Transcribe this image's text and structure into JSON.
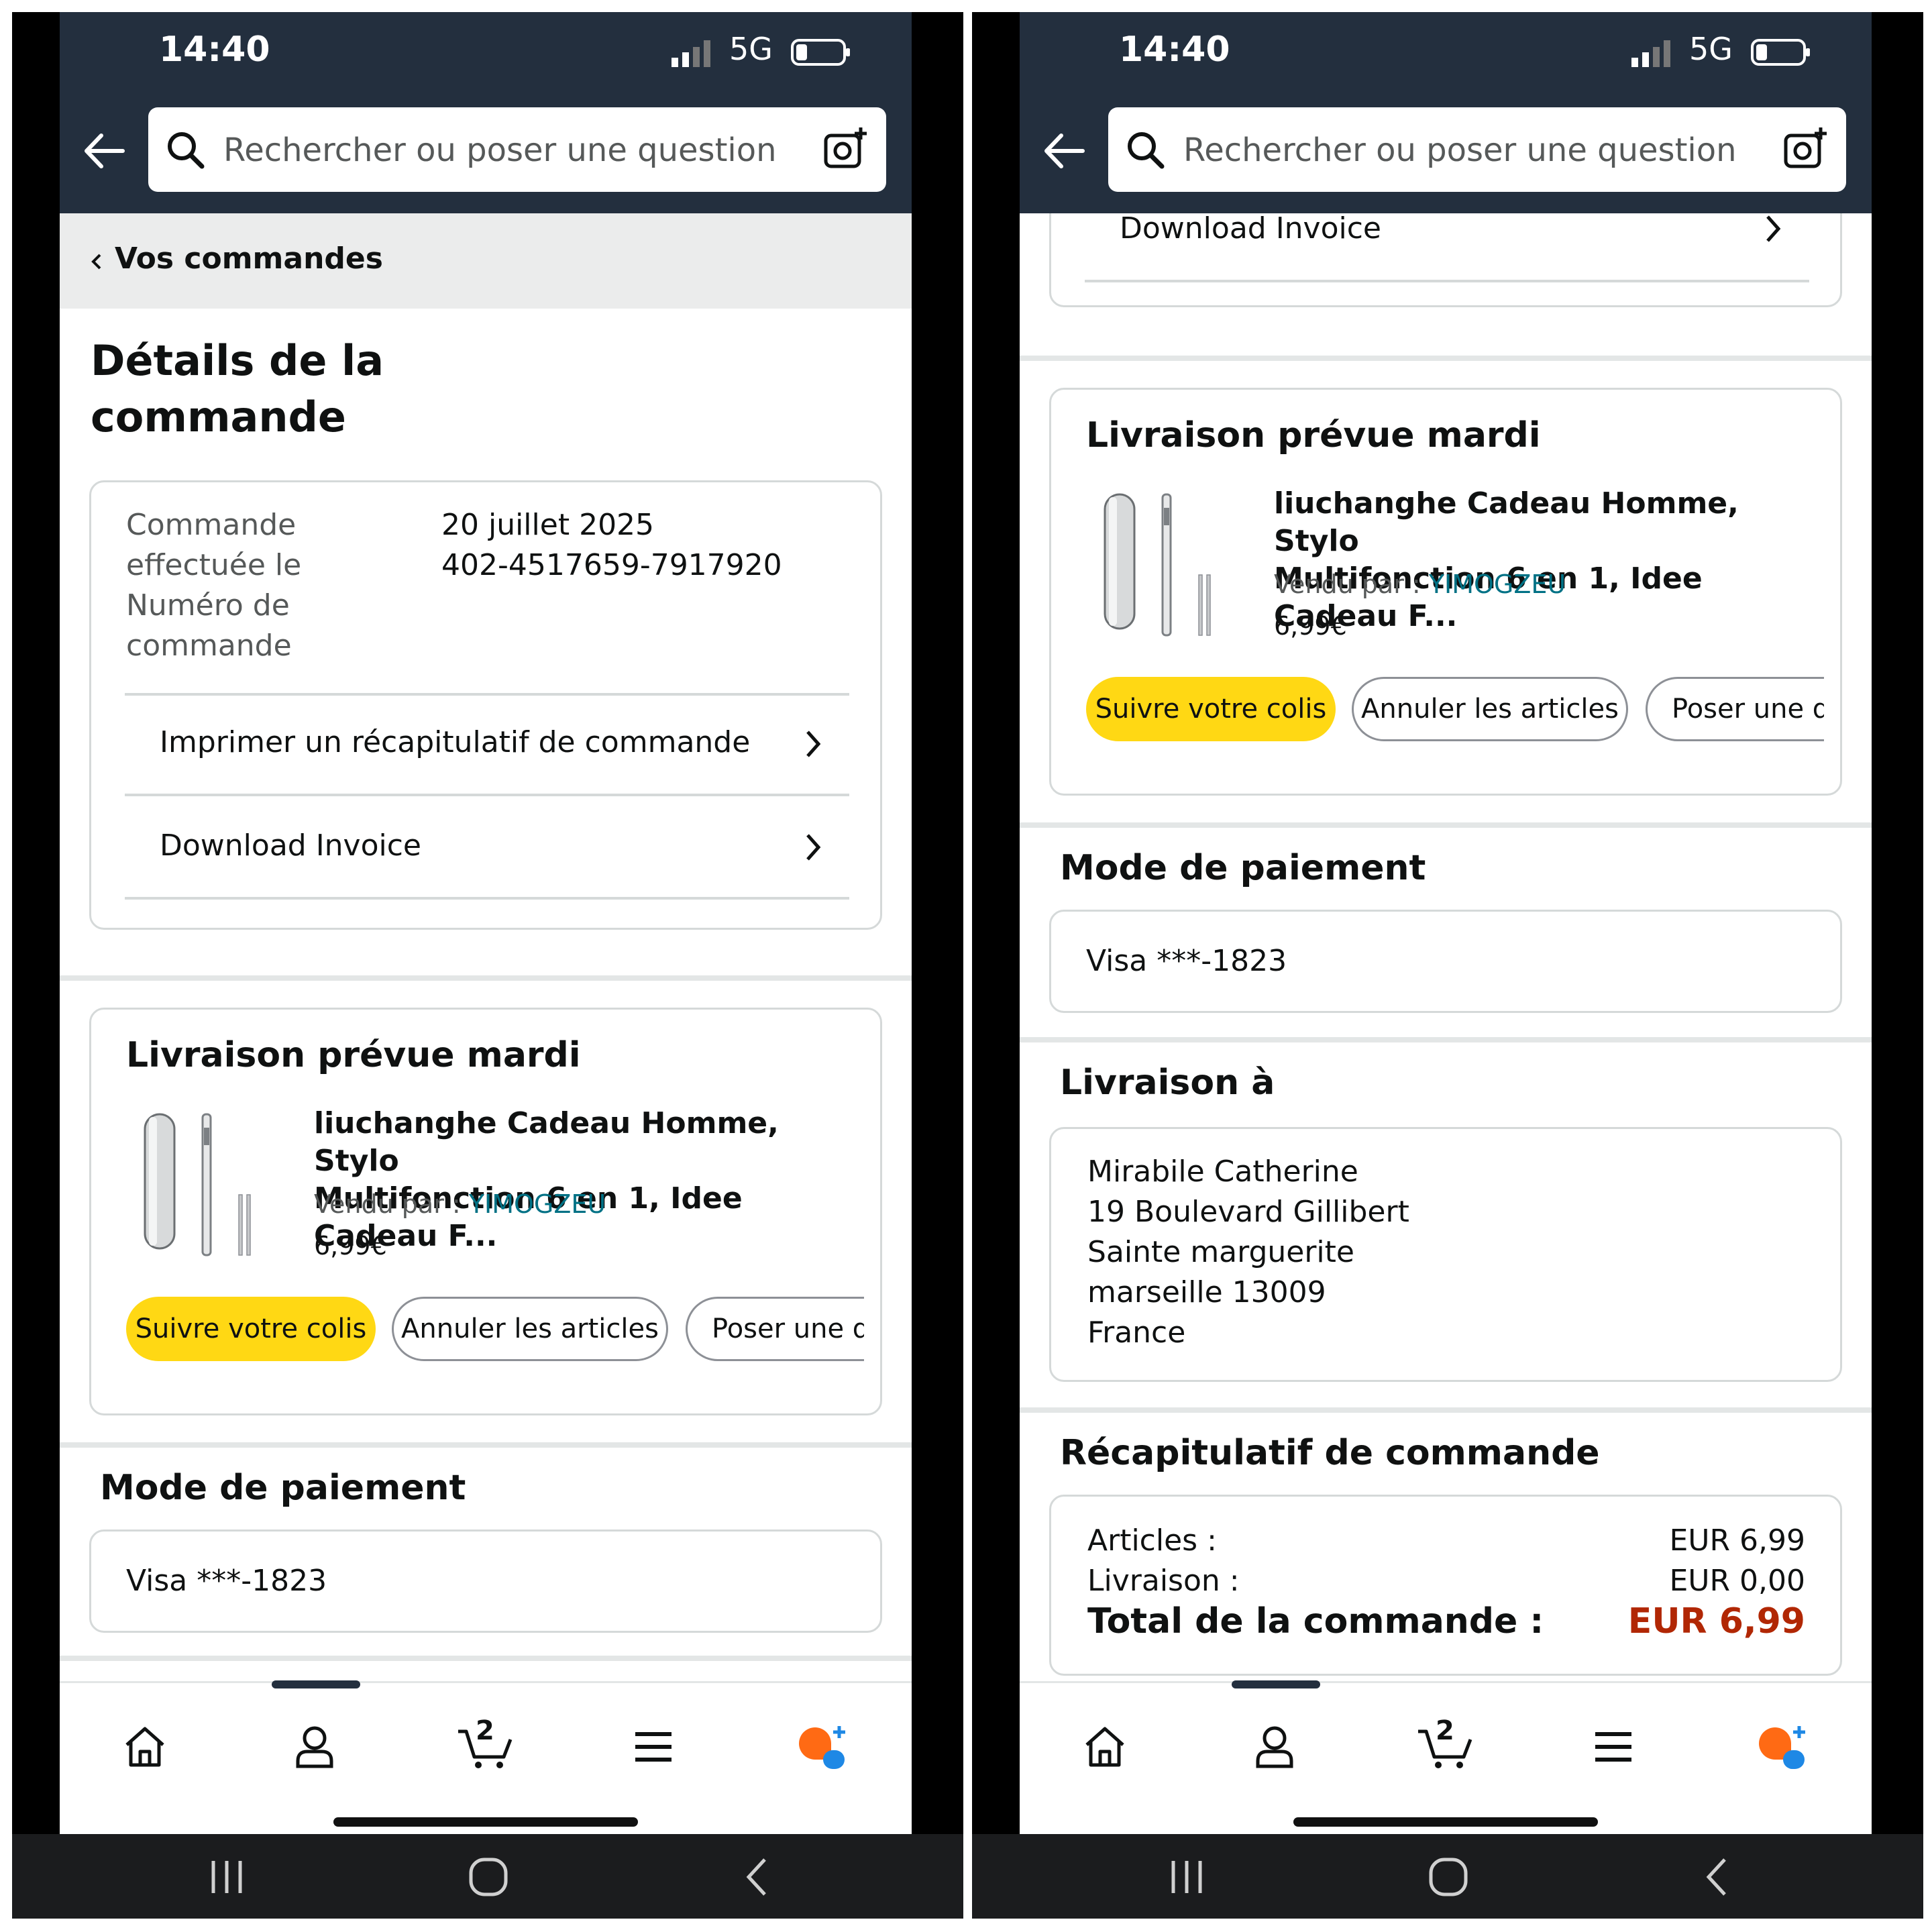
{
  "screens": [
    {
      "status_bar": {
        "time": "14:40",
        "network": "5G"
      },
      "search": {
        "placeholder": "Rechercher ou poser une question"
      },
      "breadcrumb": {
        "label": "Vos commandes"
      },
      "page_title": "Détails de la commande",
      "order_info": {
        "placed_label_1": "Commande",
        "placed_label_2": "effectuée le",
        "number_label_1": "Numéro de",
        "number_label_2": "commande",
        "placed_value": "20 juillet 2025",
        "number_value": "402-4517659-7917920"
      },
      "links": {
        "print_summary": "Imprimer un récapitulatif de commande",
        "download_invoice": "Download Invoice"
      },
      "delivery": {
        "title": "Livraison prévue mardi",
        "product_name_1": "liuchanghe Cadeau Homme, Stylo",
        "product_name_2": "Multifonction 6 en 1, Idee Cadeau F...",
        "seller_label": "Vendu par  : ",
        "seller_name": "YIMOGZEU",
        "price": "6,99€",
        "buttons": {
          "track": "Suivre votre colis",
          "cancel": "Annuler les articles",
          "ask": "Poser une qu"
        }
      },
      "payment": {
        "title": "Mode de paiement",
        "card": "Visa  ***-1823"
      },
      "bottom_nav": {
        "cart_count": "2"
      }
    },
    {
      "status_bar": {
        "time": "14:40",
        "network": "5G"
      },
      "search": {
        "placeholder": "Rechercher ou poser une question"
      },
      "links": {
        "download_invoice": "Download Invoice"
      },
      "delivery": {
        "title": "Livraison prévue mardi",
        "product_name_1": "liuchanghe Cadeau Homme, Stylo",
        "product_name_2": "Multifonction 6 en 1, Idee Cadeau F...",
        "seller_label": "Vendu par  : ",
        "seller_name": "YIMOGZEU",
        "price": "6,99€",
        "buttons": {
          "track": "Suivre votre colis",
          "cancel": "Annuler les articles",
          "ask": "Poser une qu"
        }
      },
      "payment": {
        "title": "Mode de paiement",
        "card": "Visa  ***-1823"
      },
      "shipping": {
        "title": "Livraison à",
        "lines": [
          "Mirabile Catherine",
          "19 Boulevard Gillibert",
          "Sainte marguerite",
          "marseille 13009",
          "France"
        ]
      },
      "summary": {
        "title": "Récapitulatif de commande",
        "items_label": "Articles :",
        "items_value": "EUR 6,99",
        "shipping_label": "Livraison :",
        "shipping_value": "EUR 0,00",
        "total_label": "Total de la commande :",
        "total_value": "EUR 6,99"
      },
      "bottom_nav": {
        "cart_count": "2"
      }
    }
  ],
  "colors": {
    "header": "#232f3e",
    "primary_button": "#ffd814",
    "link": "#007185",
    "total": "#b12704"
  }
}
